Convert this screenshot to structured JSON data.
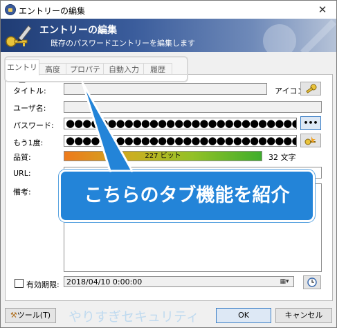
{
  "window": {
    "title": "エントリーの編集",
    "close_glyph": "✕"
  },
  "banner": {
    "title": "エントリーの編集",
    "subtitle": "既存のパスワードエントリーを編集します"
  },
  "tabs": [
    {
      "label": "エントリー",
      "active": true
    },
    {
      "label": "高度",
      "active": false
    },
    {
      "label": "プロパティ",
      "active": false
    },
    {
      "label": "自動入力",
      "active": false
    },
    {
      "label": "履歴",
      "active": false
    }
  ],
  "form": {
    "title_label": "タイトル:",
    "icon_label": "アイコン:",
    "username_label": "ユーザ名:",
    "password_label": "パスワード:",
    "repeat_label": "もう1度:",
    "password_mask": "●●●●●●●●●●●●●●●●●●●●●●●●●●●●●●●●●●●●●",
    "show_password_glyph": "•••",
    "quality_label": "品質:",
    "quality_text": "227 ビット",
    "quality_fraction": 1.0,
    "quality_chars": "32 文字",
    "url_label": "URL:",
    "notes_label": "備考:",
    "expiry_label": "有効期限:",
    "expiry_value": "2018/04/10   0:00:00"
  },
  "footer": {
    "tools_label": "ツール(T)",
    "ok_label": "OK",
    "cancel_label": "キャンセル"
  },
  "overlay": {
    "callout_text": "こちらのタブ機能を紹介",
    "watermark": "やりすぎセキュリティ"
  },
  "colors": {
    "banner_dark": "#1f3c74",
    "callout_blue": "#2384d8",
    "accent_blue": "#3c7fc6"
  }
}
